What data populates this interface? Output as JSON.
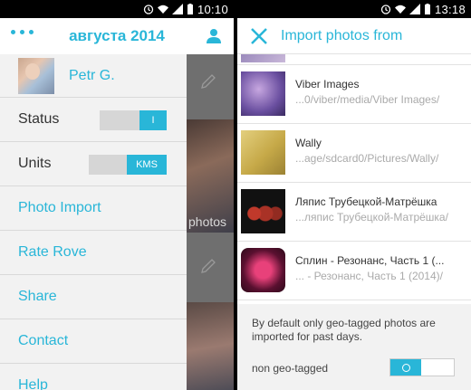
{
  "left": {
    "statusbar": {
      "time": "10:10"
    },
    "appbar": {
      "title": "августа 2014"
    },
    "background": {
      "text1": "photos"
    },
    "drawer": {
      "profile": {
        "name": "Petr G."
      },
      "status": {
        "label": "Status",
        "toggle_text": "I",
        "state": "on"
      },
      "units": {
        "label": "Units",
        "toggle_text": "KMS",
        "state": "on"
      },
      "links": [
        {
          "label": "Photo Import"
        },
        {
          "label": "Rate Rove"
        },
        {
          "label": "Share"
        },
        {
          "label": "Contact"
        },
        {
          "label": "Help"
        }
      ]
    }
  },
  "right": {
    "statusbar": {
      "time": "13:18"
    },
    "appbar": {
      "title": "Import photos from"
    },
    "items": [
      {
        "name": "",
        "path": ""
      },
      {
        "name": "Viber Images",
        "path": "...0/viber/media/Viber Images/"
      },
      {
        "name": "Wally",
        "path": "...age/sdcard0/Pictures/Wally/"
      },
      {
        "name": "Ляпис Трубецкой-Матрёшка",
        "path": "...ляпис Трубецкой-Матрёшка/"
      },
      {
        "name": "Сплин - Резонанс, Часть 1 (...",
        "path": "... - Резонанс, Часть 1 (2014)/"
      }
    ],
    "footer": {
      "note": "By default only geo-tagged photos are imported for past days.",
      "geo_label": "non geo-tagged",
      "geo_toggle_state": "on"
    }
  },
  "colors": {
    "accent": "#29b6d8",
    "drawer_bg": "#f2f2f2"
  }
}
